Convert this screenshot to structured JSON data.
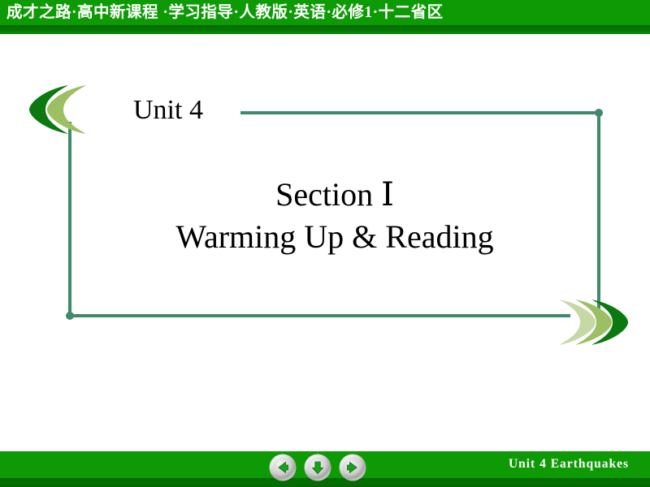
{
  "header": {
    "title": "成才之路·高中新课程 ·学习指导·人教版·英语·必修1·十二省区",
    "bar_color": "#0d9a05",
    "shadow_color": "#046a02",
    "text_color": "#ffffff"
  },
  "slide": {
    "unit_label": "Unit 4",
    "section_line1": "Section  Ⅰ",
    "section_line2": "Warming Up & Reading",
    "frame_color": "#3f8a6b",
    "text_color": "#000000"
  },
  "ornaments": {
    "left_chevrons": {
      "direction": "left",
      "colors": [
        "#0a7a10",
        "#9cbf63",
        "#c6d9a4"
      ]
    },
    "right_chevrons": {
      "direction": "right",
      "colors": [
        "#c6d9a4",
        "#9cbf63",
        "#0a7a10"
      ]
    }
  },
  "footer": {
    "title": "Unit  4   Earthquakes",
    "bar_color": "#0d9a05",
    "shadow_color": "#046a02",
    "text_color": "#ffffff",
    "buttons": [
      {
        "name": "previous-slide-button",
        "icon": "arrow-left-icon",
        "label": "Previous"
      },
      {
        "name": "down-button",
        "icon": "arrow-down-icon",
        "label": "Down"
      },
      {
        "name": "next-slide-button",
        "icon": "arrow-right-icon",
        "label": "Next"
      }
    ],
    "button_ring_color": "#d8d8d8",
    "button_arrow_color": "#17a01a"
  }
}
